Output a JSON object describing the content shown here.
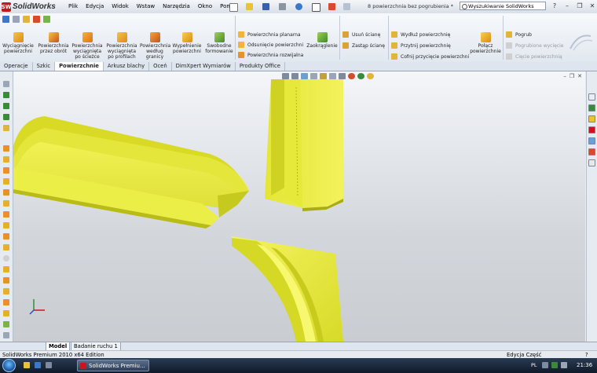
{
  "app": {
    "logo_badge": "SW",
    "logo_text": "SolidWorks",
    "document_title": "8 powierzchnia bez pogrubienia *"
  },
  "menu": [
    "Plik",
    "Edycja",
    "Widok",
    "Wstaw",
    "Narzędzia",
    "Okno",
    "Pomoc"
  ],
  "search": {
    "placeholder": "Wyszukiwanie SolidWorks"
  },
  "window_controls": {
    "minimize": "–",
    "restore": "❐",
    "close": "✕"
  },
  "ribbon": {
    "large_buttons": [
      {
        "label": "Wyciągnięcie powierzchni",
        "icon": "extruded-surface-icon"
      },
      {
        "label": "Powierzchnia przez obrót",
        "icon": "revolved-surface-icon"
      },
      {
        "label": "Powierzchnia wyciągnięta po ścieżce",
        "icon": "swept-surface-icon"
      },
      {
        "label": "Powierzchnia wyciągnięta po profilach",
        "icon": "lofted-surface-icon"
      },
      {
        "label": "Powierzchnia według granicy",
        "icon": "boundary-surface-icon"
      },
      {
        "label": "Wypełnienie powierzchni",
        "icon": "filled-surface-icon"
      },
      {
        "label": "Swobodne formowanie",
        "icon": "freeform-icon"
      }
    ],
    "group_planar": [
      "Powierzchnia planarna",
      "Odsunięcie powierzchni",
      "Powierzchnia rozwijalna"
    ],
    "fillet": "Zaokrąglenie",
    "group_delete": [
      "Usuń ścianę",
      "Zastąp ścianę"
    ],
    "group_extend": [
      "Wydłuż powierzchnię",
      "Przytnij powierzchnię",
      "Cofnij przycięcie powierzchni"
    ],
    "knit": "Połącz powierzchnie",
    "group_thicken": [
      {
        "label": "Pogrub",
        "enabled": true
      },
      {
        "label": "Pogrubione wycięcie",
        "enabled": false
      },
      {
        "label": "Cięcie powierzchnią",
        "enabled": false
      }
    ]
  },
  "command_tabs": [
    {
      "label": "Operacje",
      "active": false
    },
    {
      "label": "Szkic",
      "active": false
    },
    {
      "label": "Powierzchnie",
      "active": true
    },
    {
      "label": "Arkusz blachy",
      "active": false
    },
    {
      "label": "Oceń",
      "active": false
    },
    {
      "label": "DimXpert Wymiarów",
      "active": false
    },
    {
      "label": "Produkty Office",
      "active": false
    }
  ],
  "model_tabs": [
    {
      "label": "Model",
      "active": true
    },
    {
      "label": "Badanie ruchu 1",
      "active": false
    }
  ],
  "status": {
    "left": "SolidWorks Premium 2010 x64 Edition",
    "mode": "Edycja Część",
    "help": "?"
  },
  "taskbar": {
    "task_button": "SolidWorks Premiu...",
    "language": "PL",
    "clock": "21:36"
  },
  "colors": {
    "surface_yellow": "#e8e832",
    "surface_shadow": "#a9ac14",
    "accent_red": "#c8161d"
  }
}
